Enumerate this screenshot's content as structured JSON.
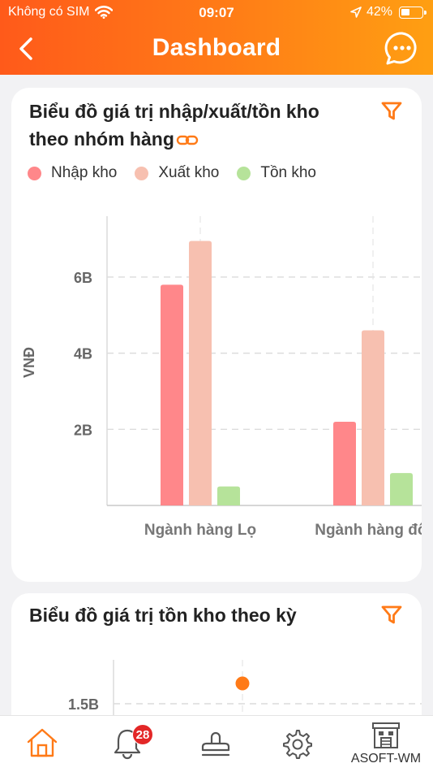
{
  "status_bar": {
    "carrier": "Không có SIM",
    "time": "09:07",
    "battery": "42%"
  },
  "nav": {
    "title": "Dashboard"
  },
  "colors": {
    "accent": "#ff7a17",
    "import": "#ff878a",
    "export": "#f7c0b0",
    "stock": "#b6e39a"
  },
  "card1": {
    "title_line1": "Biểu đồ giá trị nhập/xuất/tồn kho",
    "title_line2": "theo nhóm hàng",
    "legend": [
      "Nhập kho",
      "Xuất kho",
      "Tồn kho"
    ]
  },
  "card2": {
    "title": "Biểu đồ giá trị tồn kho theo kỳ"
  },
  "chart_data": [
    {
      "type": "bar",
      "title": "Biểu đồ giá trị nhập/xuất/tồn kho theo nhóm hàng",
      "ylabel": "VNĐ",
      "categories": [
        "Ngành hàng Lọ",
        "Ngành hàng đôi"
      ],
      "series": [
        {
          "name": "Nhập kho",
          "values": [
            5.8,
            2.2
          ]
        },
        {
          "name": "Xuất kho",
          "values": [
            6.95,
            4.6
          ]
        },
        {
          "name": "Tồn kho",
          "values": [
            0.5,
            0.85
          ]
        }
      ],
      "yticks": [
        "2B",
        "4B",
        "6B"
      ],
      "ylim": [
        0,
        7.6
      ],
      "grid": true,
      "legend": "top"
    },
    {
      "type": "scatter",
      "title": "Biểu đồ giá trị tồn kho theo kỳ",
      "yticks": [
        "1.5B"
      ],
      "values": [
        1.55
      ],
      "grid": true
    }
  ],
  "tabbar": {
    "items": [
      {
        "name": "home-tab",
        "icon": "home-icon"
      },
      {
        "name": "notifications-tab",
        "icon": "bell-icon",
        "badge": "28"
      },
      {
        "name": "stamp-tab",
        "icon": "stamp-icon"
      },
      {
        "name": "settings-tab",
        "icon": "gear-icon"
      },
      {
        "name": "asoft-wm-tab",
        "icon": "warehouse-icon",
        "label": "ASOFT-WM"
      }
    ]
  }
}
